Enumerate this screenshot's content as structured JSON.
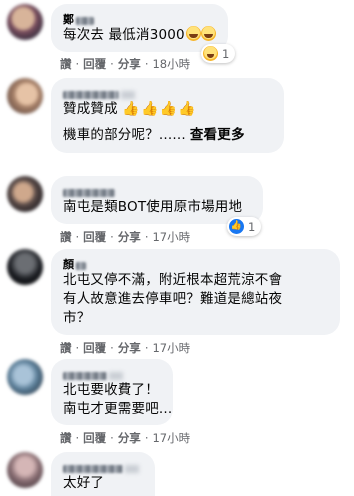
{
  "comments": [
    {
      "author": "鄭",
      "lines": [
        "每次去 最低消3000"
      ],
      "emoji_count": "1",
      "actions": {
        "like": "讚",
        "reply": "回覆",
        "share": "分享",
        "time": "18小時"
      }
    },
    {
      "author": "",
      "lines": [
        "贊成贊成",
        "機車的部分呢？......"
      ],
      "see_more": "查看更多"
    },
    {
      "author": "",
      "lines": [
        "南屯是類BOT使用原市場用地"
      ],
      "like_count": "1",
      "actions": {
        "like": "讚",
        "reply": "回覆",
        "share": "分享",
        "time": "17小時"
      }
    },
    {
      "author": "顏",
      "lines": [
        "北屯又停不滿，附近根本超荒涼不會",
        "有人故意進去停車吧？難道是總站夜",
        "市？"
      ],
      "actions": {
        "like": "讚",
        "reply": "回覆",
        "share": "分享",
        "time": "17小時"
      }
    },
    {
      "author": "",
      "lines": [
        "北屯要收費了！",
        "南屯才更需要吧..."
      ],
      "actions": {
        "like": "讚",
        "reply": "回覆",
        "share": "分享",
        "time": "17小時"
      }
    },
    {
      "author": "",
      "lines": [
        "太好了"
      ]
    }
  ],
  "icons": {
    "haha": "haha-reaction-icon",
    "like": "like-reaction-icon",
    "thumbs": "thumbs-up-emoji"
  },
  "colors": {
    "bubble": "#f0f2f5",
    "meta": "#65676b",
    "like_blue": "#1877f2"
  }
}
